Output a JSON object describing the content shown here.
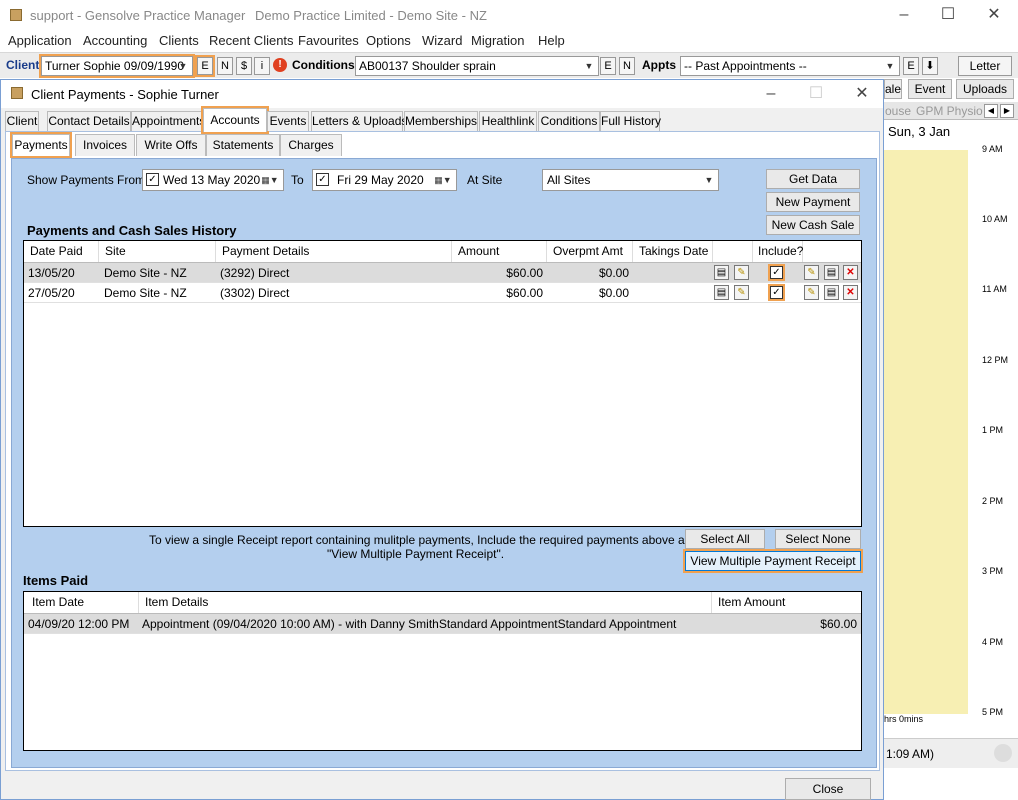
{
  "app": {
    "title": "support - Gensolve Practice Manager",
    "site": "Demo Practice Limited  - Demo Site - NZ",
    "menu": [
      "Application",
      "Accounting",
      "Clients",
      "Recent Clients",
      "Favourites",
      "Options",
      "Wizard",
      "Migration",
      "Help"
    ]
  },
  "clientbar": {
    "client_label": "Client",
    "client_value": "Turner Sophie 09/09/1990",
    "btn_e": "E",
    "btn_n": "N",
    "btn_dollar": "$",
    "btn_i": "i",
    "conditions_label": "Conditions",
    "conditions_value": "AB00137 Shoulder sprain",
    "cond_e": "E",
    "cond_n": "N",
    "appts_label": "Appts",
    "appts_value": "-- Past Appointments --",
    "appts_e": "E",
    "letter": "Letter",
    "event": "Event",
    "uploads": "Uploads",
    "sale_partial": "ale"
  },
  "calendar": {
    "tab_house": "ouse",
    "tab_gpm": "GPM Physio",
    "date": "Sun, 3 Jan",
    "times": [
      "9 AM",
      "10 AM",
      "11 AM",
      "12 PM",
      "1 PM",
      "2 PM",
      "3 PM",
      "4 PM",
      "5 PM"
    ],
    "footer_hrs": "hrs 0mins",
    "footer_time": "1:09 AM)"
  },
  "dialog": {
    "title": "Client Payments - Sophie Turner",
    "tabs": [
      "Client",
      "Contact Details",
      "Appointments",
      "Accounts",
      "Events",
      "Letters & Uploads",
      "Memberships",
      "Healthlink",
      "Conditions",
      "Full History"
    ],
    "subtabs": [
      "Payments",
      "Invoices",
      "Write Offs",
      "Statements",
      "Charges"
    ],
    "filter": {
      "show_from_label": "Show Payments From",
      "from_date": "Wed 13 May 2020",
      "to_label": "To",
      "to_date": "Fri   29 May 2020",
      "at_site_label": "At Site",
      "site_value": "All Sites"
    },
    "buttons": {
      "get_data": "Get Data",
      "new_payment": "New Payment",
      "new_cash_sale": "New Cash Sale",
      "select_all": "Select All",
      "select_none": "Select None",
      "view_multiple": "View Multiple Payment Receipt",
      "close": "Close"
    },
    "history_heading": "Payments and Cash Sales History",
    "history_columns": [
      "Date Paid",
      "Site",
      "Payment Details",
      "Amount",
      "Overpmt Amt",
      "Takings Date",
      "",
      "Include?"
    ],
    "history_rows": [
      {
        "date": "13/05/20",
        "site": "Demo Site - NZ",
        "details": "(3292) Direct",
        "amount": "$60.00",
        "overpmt": "$0.00",
        "takings": "",
        "include": true
      },
      {
        "date": "27/05/20",
        "site": "Demo Site - NZ",
        "details": "(3302) Direct",
        "amount": "$60.00",
        "overpmt": "$0.00",
        "takings": "",
        "include": true
      }
    ],
    "receipt_note_1": "To view a single Receipt report containing mulitple payments, Include the required payments above and press",
    "receipt_note_2": "\"View Multiple Payment Receipt\".",
    "items_heading": "Items Paid",
    "items_columns": [
      "Item Date",
      "Item Details",
      "Item Amount"
    ],
    "items_rows": [
      {
        "date": "04/09/20 12:00 PM",
        "details": "Appointment (09/04/2020 10:00 AM) - with Danny SmithStandard AppointmentStandard Appointment",
        "amount": "$60.00"
      }
    ]
  },
  "colors": {
    "panel_blue": "#b4cfee",
    "highlight_orange": "#f0a150",
    "calendar_yellow": "#f7efb3"
  }
}
